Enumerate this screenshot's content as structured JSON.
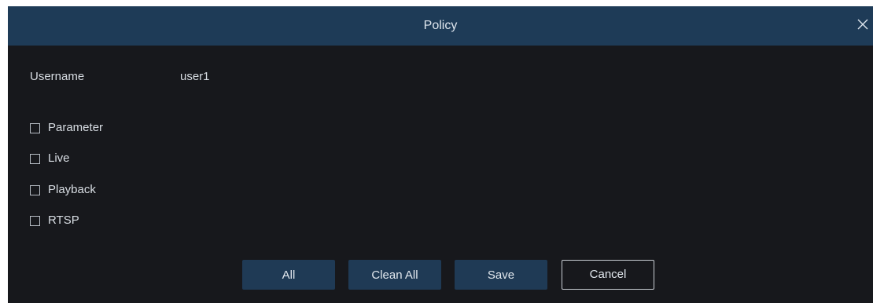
{
  "dialog": {
    "title": "Policy",
    "close_icon": "close-icon"
  },
  "user": {
    "label": "Username",
    "value": "user1"
  },
  "permissions": [
    {
      "label": "Parameter",
      "checked": false
    },
    {
      "label": "Live",
      "checked": false
    },
    {
      "label": "Playback",
      "checked": false
    },
    {
      "label": "RTSP",
      "checked": false
    }
  ],
  "buttons": {
    "all": "All",
    "clean_all": "Clean All",
    "save": "Save",
    "cancel": "Cancel"
  },
  "colors": {
    "titlebar": "#1e3b57",
    "background": "#17181c",
    "button": "#1f3a55"
  }
}
